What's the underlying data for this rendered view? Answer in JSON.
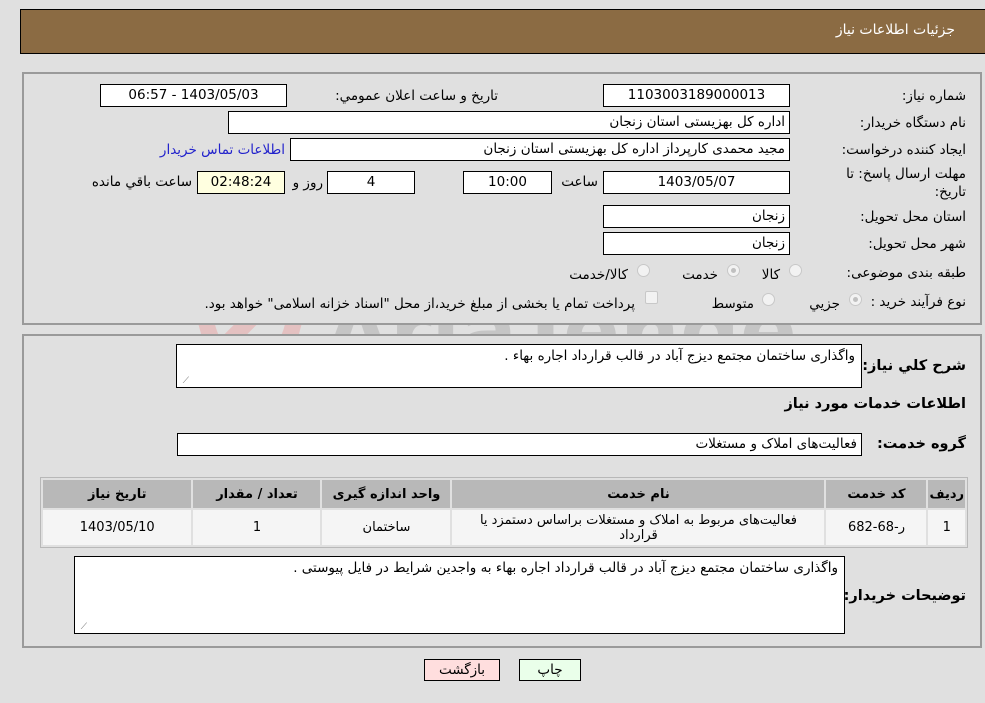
{
  "header": {
    "title": "جزئیات اطلاعات نیاز"
  },
  "form": {
    "need_number_label": "شماره نیاز:",
    "need_number": "1103003189000013",
    "announce_label": "تاریخ و ساعت اعلان عمومي:",
    "announce_value": "1403/05/03 - 06:57",
    "buyer_org_label": "نام دستگاه خریدار:",
    "buyer_org": "اداره کل بهزیستی استان زنجان",
    "creator_label": "ایجاد کننده درخواست:",
    "creator": "مجید محمدی کارپرداز اداره کل بهزیستی استان زنجان",
    "contact_link": "اطلاعات تماس خریدار",
    "deadline_label_line1": "مهلت ارسال پاسخ: تا",
    "deadline_label_line2": "تاریخ:",
    "deadline_date": "1403/05/07",
    "time_label": "ساعت",
    "deadline_time": "10:00",
    "days_value": "4",
    "days_label": "روز و",
    "remaining_time": "02:48:24",
    "remaining_label": "ساعت باقي مانده",
    "province_label": "استان محل تحویل:",
    "province": "زنجان",
    "city_label": "شهر محل تحویل:",
    "city": "زنجان",
    "category_label": "طبقه بندی موضوعی:",
    "category_options": [
      {
        "label": "کالا",
        "selected": false
      },
      {
        "label": "خدمت",
        "selected": true
      },
      {
        "label": "کالا/خدمت",
        "selected": false
      }
    ],
    "process_label": "نوع فرآیند خرید :",
    "process_options": [
      {
        "label": "جزیي",
        "selected": true
      },
      {
        "label": "متوسط",
        "selected": false
      }
    ],
    "treasury_note": "پرداخت تمام یا بخشی از مبلغ خرید،از محل \"اسناد خزانه اسلامی\" خواهد بود."
  },
  "details": {
    "summary_label": "شرح کلي نیاز:",
    "summary": "واگذاری ساختمان مجتمع دیزج آباد در قالب قرارداد اجاره بهاء .",
    "services_heading": "اطلاعات خدمات مورد نیاز",
    "service_group_label": "گروه خدمت:",
    "service_group": "فعالیت‌های  املاک و مستغلات",
    "table": {
      "headers": [
        "ردیف",
        "کد خدمت",
        "نام خدمت",
        "واحد اندازه گیری",
        "تعداد / مقدار",
        "تاریخ نیاز"
      ],
      "rows": [
        [
          "1",
          "ر-68-682",
          "فعالیت‌های مربوط به املاک و مستغلات براساس دستمزد یا قرارداد",
          "ساختمان",
          "1",
          "1403/05/10"
        ]
      ]
    },
    "buyer_notes_label": "توضیحات خریدار:",
    "buyer_notes": "واگذاری ساختمان مجتمع دیزج آباد در قالب قرارداد اجاره بهاء به واجدین شرایط در فایل پیوستی ."
  },
  "buttons": {
    "print": "چاپ",
    "back": "بازگشت"
  },
  "colors": {
    "header_bg": "#8b6b43",
    "print_bg": "#eaffea",
    "back_bg": "#ffdede",
    "link": "#2222cc"
  },
  "watermark": {
    "text": "AriaTender.neT"
  }
}
